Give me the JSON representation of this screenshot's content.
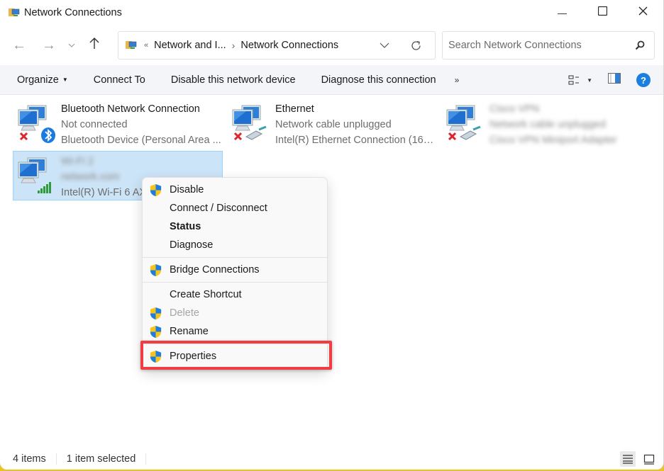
{
  "window": {
    "title": "Network Connections",
    "controls": {
      "minimize": "—",
      "maximize": "☐",
      "close": "✕"
    }
  },
  "navbar": {
    "back_icon": "←",
    "forward_icon": "→",
    "recent_icon": "⌄",
    "up_icon": "↑",
    "breadcrumb": {
      "overflow": "«",
      "items": [
        "Network and I...",
        "Network Connections"
      ],
      "separator": "›"
    },
    "search": {
      "placeholder": "Search Network Connections",
      "value": ""
    }
  },
  "commandbar": {
    "items": [
      {
        "label": "Organize",
        "has_caret": true
      },
      {
        "label": "Connect To"
      },
      {
        "label": "Disable this network device"
      },
      {
        "label": "Diagnose this connection"
      }
    ],
    "more": "»",
    "help": "?"
  },
  "connections": [
    {
      "name": "Bluetooth Network Connection",
      "status": "Not connected",
      "device": "Bluetooth Device (Personal Area ...",
      "icon": "bluetooth",
      "disconnected": true,
      "selected": false,
      "blurred": false
    },
    {
      "name": "Ethernet",
      "status": "Network cable unplugged",
      "device": "Intel(R) Ethernet Connection (16) I...",
      "icon": "ethernet",
      "disconnected": true,
      "selected": false,
      "blurred": false
    },
    {
      "name": "Cisco VPN",
      "status": "Network cable unplugged",
      "device": "Cisco VPN Miniport Adapter",
      "icon": "ethernet",
      "disconnected": true,
      "selected": false,
      "blurred": true
    },
    {
      "name": "Wi-Fi 2",
      "status": "network.com",
      "device": "Intel(R) Wi-Fi 6 AX201 160MHz",
      "icon": "wifi",
      "disconnected": false,
      "selected": true,
      "blurred_name": true
    }
  ],
  "context_menu": {
    "items": [
      {
        "label": "Disable",
        "shield": true
      },
      {
        "label": "Connect / Disconnect",
        "shield": false
      },
      {
        "label": "Status",
        "shield": false,
        "bold": true
      },
      {
        "label": "Diagnose",
        "shield": false
      },
      {
        "separator": true
      },
      {
        "label": "Bridge Connections",
        "shield": true
      },
      {
        "separator": true
      },
      {
        "label": "Create Shortcut",
        "shield": false
      },
      {
        "label": "Delete",
        "shield": true,
        "disabled": true
      },
      {
        "label": "Rename",
        "shield": true
      },
      {
        "separator": true
      },
      {
        "label": "Properties",
        "shield": true,
        "highlighted": true
      }
    ],
    "highlight_color": "#ef3d43"
  },
  "statusbar": {
    "item_count": "4 items",
    "selection": "1 item selected"
  },
  "colors": {
    "selection_bg": "#cce4f7",
    "selection_border": "#99d1ff",
    "accent": "#1b7fe0",
    "desktop": "#e7c32a"
  }
}
